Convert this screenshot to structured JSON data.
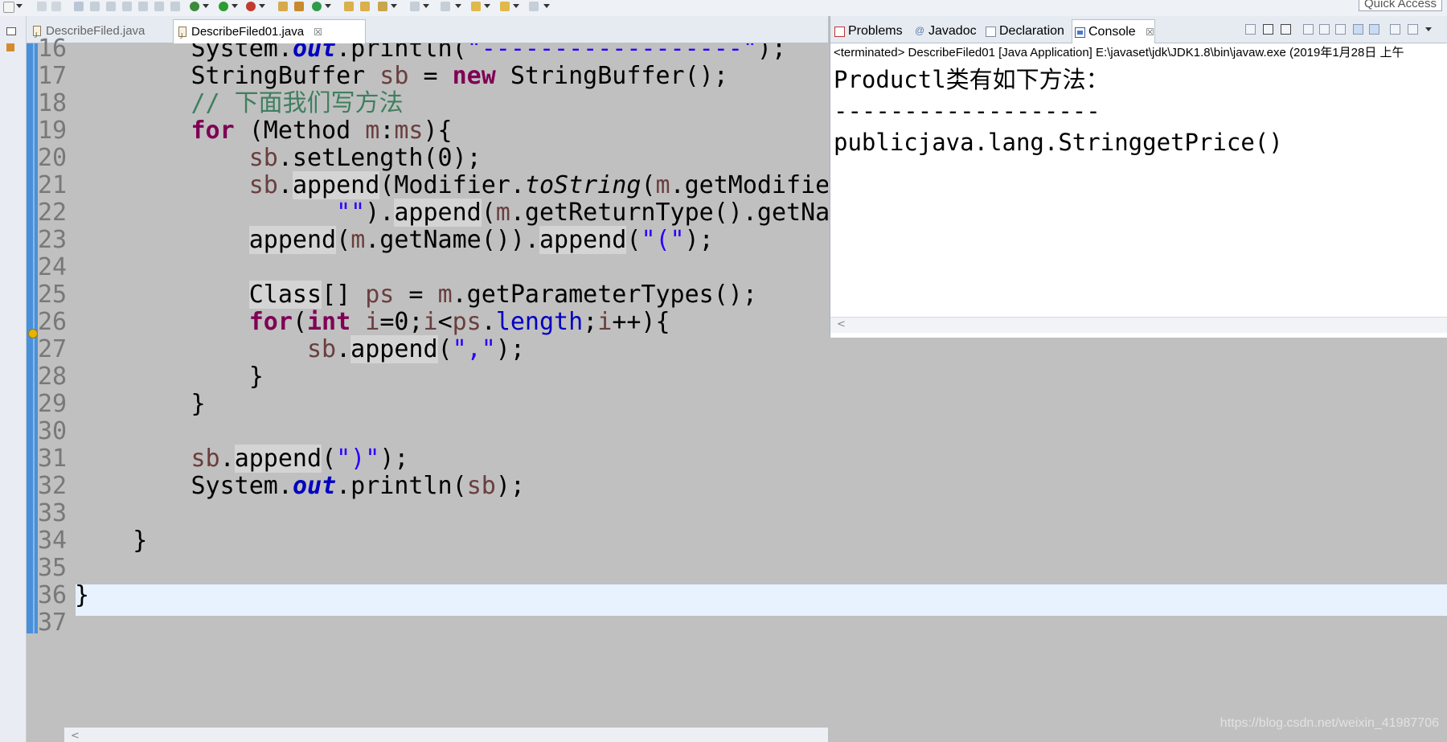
{
  "toolbar": {
    "quick_access": "Quick Access"
  },
  "editor": {
    "tabs": [
      {
        "label": "DescribeFiled.java"
      },
      {
        "label": "DescribeFiled01.java",
        "close": "☒"
      }
    ],
    "line_numbers": [
      "16",
      "17",
      "18",
      "19",
      "20",
      "21",
      "22",
      "23",
      "24",
      "25",
      "26",
      "27",
      "28",
      "29",
      "30",
      "31",
      "32",
      "33",
      "34",
      "35",
      "36",
      "37"
    ]
  },
  "console": {
    "tabs": [
      {
        "label": "Problems"
      },
      {
        "label": "Javadoc",
        "icon": "@"
      },
      {
        "label": "Declaration"
      },
      {
        "label": "Console",
        "close": "☒"
      }
    ],
    "status": "<terminated> DescribeFiled01 [Java Application] E:\\javaset\\jdk\\JDK1.8\\bin\\javaw.exe (2019年1月28日 上午",
    "output": [
      "Productl类有如下方法：",
      "-------------------",
      "publicjava.lang.StringgetPrice()"
    ]
  },
  "watermark": "https://blog.csdn.net/weixin_41987706"
}
